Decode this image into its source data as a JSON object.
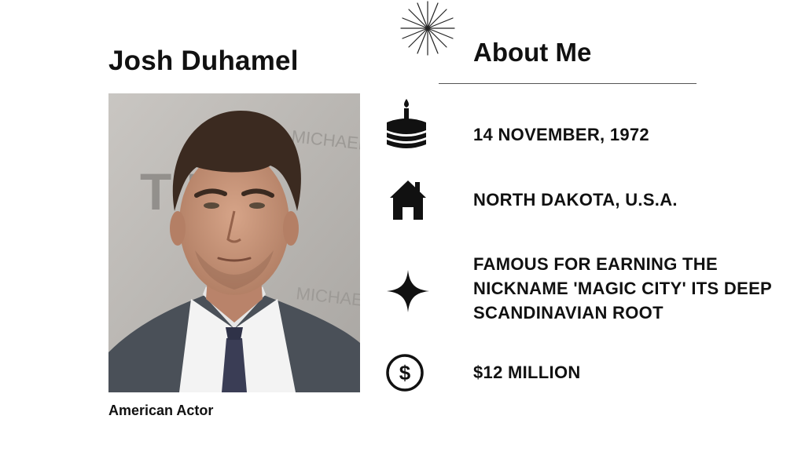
{
  "profile": {
    "name": "Josh Duhamel",
    "caption": "American Actor"
  },
  "about": {
    "title": "About Me"
  },
  "facts": [
    {
      "icon": "birthday-cake-icon",
      "text": "14 NOVEMBER, 1972"
    },
    {
      "icon": "house-icon",
      "text": "NORTH DAKOTA, U.S.A."
    },
    {
      "icon": "sparkle-star-icon",
      "text": "FAMOUS FOR EARNING THE NICKNAME 'MAGIC CITY' ITS DEEP SCANDINAVIAN ROOT"
    },
    {
      "icon": "dollar-circle-icon",
      "text": "$12 MILLION"
    }
  ],
  "photo_backdrop_text": {
    "line1": "MICHAEL BA",
    "line2": "T  F O",
    "line3": "MICHAEL BA"
  },
  "colors": {
    "background": "#ffffff",
    "text": "#111111",
    "rule": "#555555",
    "suit": "#4a5058",
    "tie": "#3a3d55"
  }
}
